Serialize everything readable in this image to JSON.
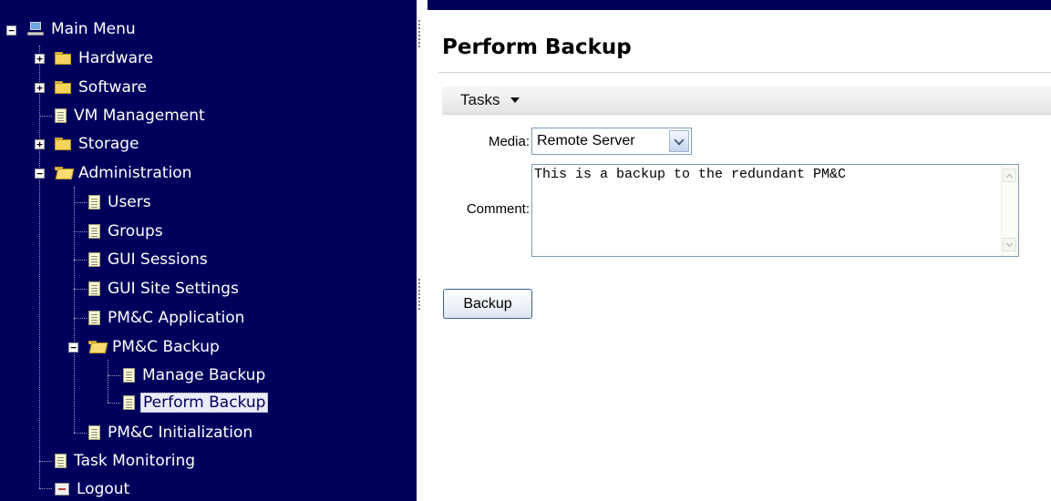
{
  "sidebar": {
    "items": [
      {
        "label": "Main Menu",
        "icon": "computer-icon",
        "expander": "-"
      },
      {
        "label": "Hardware",
        "icon": "folder-icon",
        "expander": "+"
      },
      {
        "label": "Software",
        "icon": "folder-icon",
        "expander": "+"
      },
      {
        "label": "VM Management",
        "icon": "document-icon"
      },
      {
        "label": "Storage",
        "icon": "folder-icon",
        "expander": "+"
      },
      {
        "label": "Administration",
        "icon": "folder-open-icon",
        "expander": "-"
      },
      {
        "label": "Users",
        "icon": "document-icon"
      },
      {
        "label": "Groups",
        "icon": "document-icon"
      },
      {
        "label": "GUI Sessions",
        "icon": "document-icon"
      },
      {
        "label": "GUI Site Settings",
        "icon": "document-icon"
      },
      {
        "label": "PM&C Application",
        "icon": "document-icon"
      },
      {
        "label": "PM&C Backup",
        "icon": "folder-open-icon",
        "expander": "-"
      },
      {
        "label": "Manage Backup",
        "icon": "document-icon"
      },
      {
        "label": "Perform Backup",
        "icon": "document-icon",
        "selected": true
      },
      {
        "label": "PM&C Initialization",
        "icon": "document-icon"
      },
      {
        "label": "Task Monitoring",
        "icon": "document-icon"
      },
      {
        "label": "Logout",
        "icon": "logout-icon"
      }
    ]
  },
  "main": {
    "title": "Perform Backup",
    "tasks_label": "Tasks",
    "media_label": "Media:",
    "media_value": "Remote Server",
    "comment_label": "Comment:",
    "comment_value": "This is a backup to the redundant PM&C",
    "backup_label": "Backup"
  },
  "colors": {
    "sidebar_bg": "#00005c",
    "selection_bg": "#e8ecf8"
  }
}
